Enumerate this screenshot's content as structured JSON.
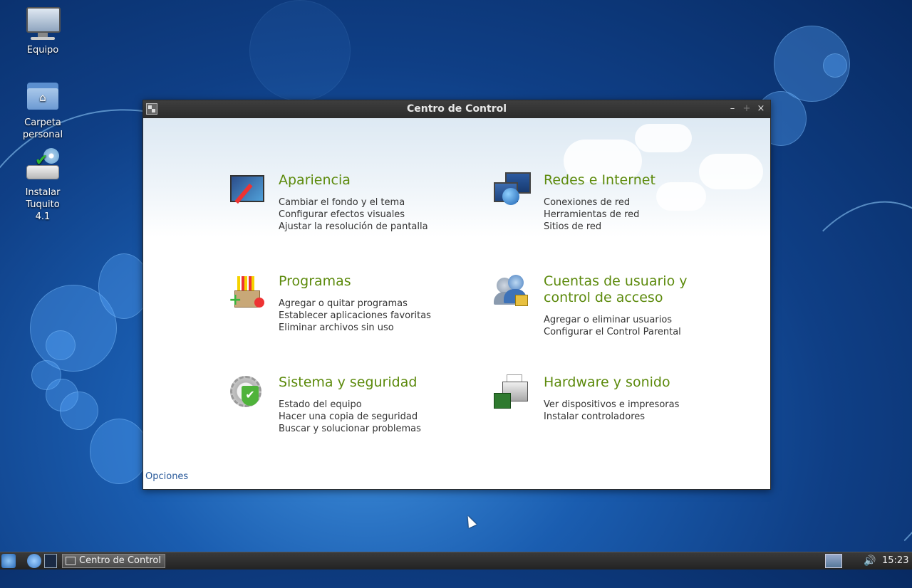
{
  "desktop": {
    "icons": [
      {
        "label": "Equipo",
        "icon": "computer-icon"
      },
      {
        "label": "Carpeta\npersonal",
        "icon": "home-folder-icon"
      },
      {
        "label": "Instalar Tuquito\n4.1",
        "icon": "installer-icon"
      }
    ]
  },
  "window": {
    "title": "Centro de Control",
    "buttons": {
      "minimize": "–",
      "maximize": "+",
      "close": "×"
    },
    "categories": [
      {
        "title": "Apariencia",
        "icon": "appearance-icon",
        "links": [
          "Cambiar el fondo y el tema",
          "Configurar efectos visuales",
          "Ajustar la resolución de pantalla"
        ]
      },
      {
        "title": "Redes e Internet",
        "icon": "network-icon",
        "links": [
          "Conexiones de red",
          "Herramientas de red",
          "Sitios de red"
        ]
      },
      {
        "title": "Programas",
        "icon": "programs-icon",
        "links": [
          "Agregar o quitar programas",
          "Establecer aplicaciones favoritas",
          "Eliminar archivos sin uso"
        ]
      },
      {
        "title": "Cuentas de usuario y control de acceso",
        "icon": "users-icon",
        "links": [
          "Agregar o eliminar usuarios",
          "Configurar el Control Parental"
        ]
      },
      {
        "title": "Sistema y seguridad",
        "icon": "system-security-icon",
        "links": [
          "Estado del equipo",
          "Hacer una copia de seguridad",
          "Buscar y solucionar problemas"
        ]
      },
      {
        "title": "Hardware y sonido",
        "icon": "hardware-icon",
        "links": [
          "Ver dispositivos e impresoras",
          "Instalar controladores"
        ]
      }
    ],
    "options_link": "Opciones"
  },
  "taskbar": {
    "task_label": "Centro de Control",
    "clock": "15:23",
    "volume_glyph": "🔊"
  }
}
